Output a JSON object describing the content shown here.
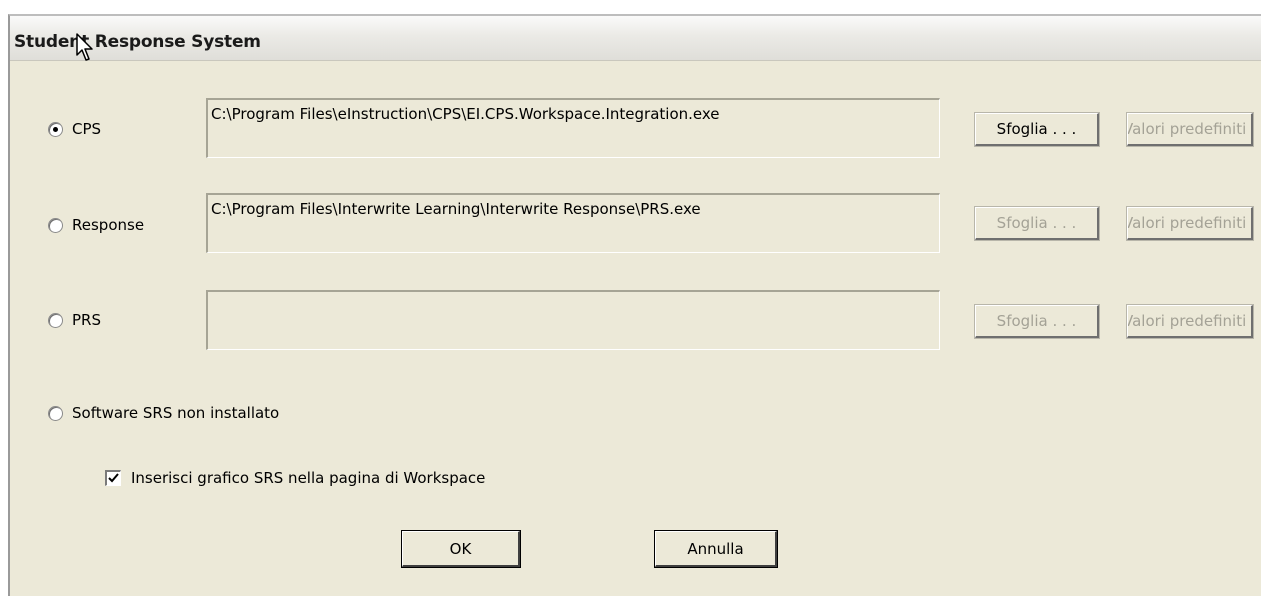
{
  "window": {
    "title": "Student Response System"
  },
  "options": [
    {
      "label": "CPS",
      "checked": true,
      "path": "C:\\Program Files\\eInstruction\\CPS\\EI.CPS.Workspace.Integration.exe",
      "browse_label": "Sfoglia . . .",
      "browse_enabled": true,
      "defaults_label": "Valori predefiniti",
      "defaults_enabled": false
    },
    {
      "label": "Response",
      "checked": false,
      "path": "C:\\Program Files\\Interwrite Learning\\Interwrite Response\\PRS.exe",
      "browse_label": "Sfoglia . . .",
      "browse_enabled": false,
      "defaults_label": "Valori predefiniti",
      "defaults_enabled": false
    },
    {
      "label": "PRS",
      "checked": false,
      "path": "",
      "browse_label": "Sfoglia . . .",
      "browse_enabled": false,
      "defaults_label": "Valori predefiniti",
      "defaults_enabled": false
    },
    {
      "label": "Software SRS non installato",
      "checked": false
    }
  ],
  "insert_graphic": {
    "label": "Inserisci grafico SRS nella pagina di Workspace",
    "checked": true
  },
  "buttons": {
    "ok": "OK",
    "cancel": "Annulla"
  },
  "icons": {
    "cursor": "arrow-cursor-icon",
    "checkbox_tick": "check-icon"
  },
  "colors": {
    "window_bg": "#ece9d8",
    "disabled_text": "#a4a296"
  }
}
